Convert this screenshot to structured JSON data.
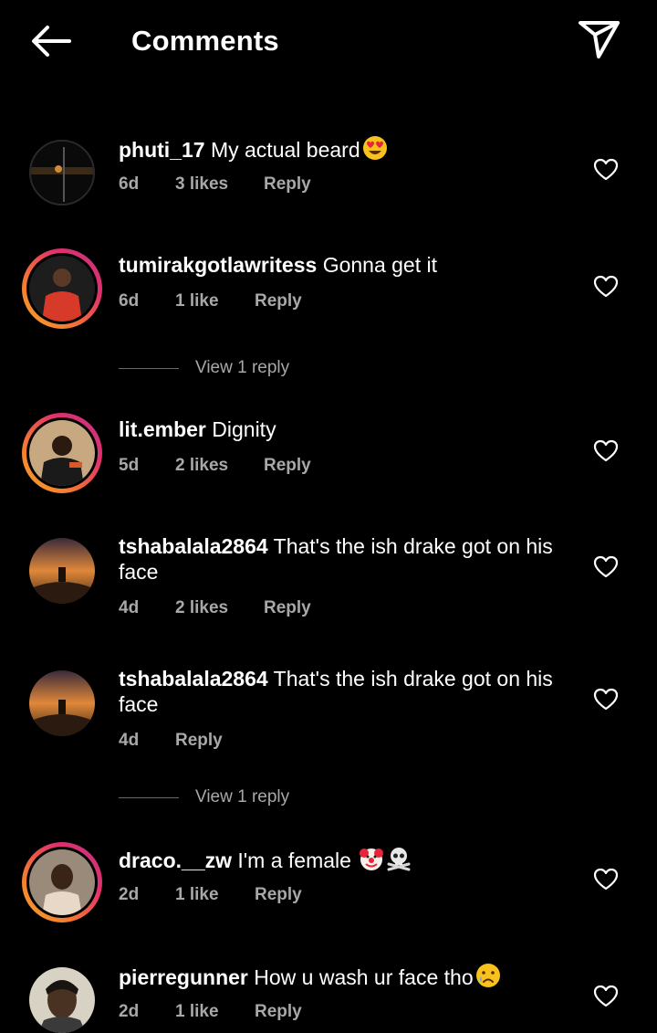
{
  "header": {
    "title": "Comments",
    "back_icon": "arrow-left-icon",
    "share_icon": "paper-plane-icon"
  },
  "comments": [
    {
      "username": "phuti_17",
      "text": "My actual beard",
      "emoji": "heart-eyes-icon",
      "time": "6d",
      "likes": "3 likes",
      "reply": "Reply"
    },
    {
      "username": "tumirakgotlawritess",
      "text": "Gonna get it",
      "time": "6d",
      "likes": "1 like",
      "reply": "Reply",
      "view_replies": "View 1 reply"
    },
    {
      "username": "lit.ember",
      "text": "Dignity",
      "time": "5d",
      "likes": "2 likes",
      "reply": "Reply"
    },
    {
      "username": "tshabalala2864",
      "text": "That's the ish drake got on his face",
      "time": "4d",
      "likes": "2 likes",
      "reply": "Reply"
    },
    {
      "username": "tshabalala2864",
      "text": "That's the ish drake got on his face",
      "time": "4d",
      "reply": "Reply",
      "view_replies": "View 1 reply"
    },
    {
      "username": "draco.__zw",
      "text": "I'm a female",
      "emoji": "clown-skull-icons",
      "time": "2d",
      "likes": "1 like",
      "reply": "Reply"
    },
    {
      "username": "pierregunner",
      "text": "How u wash ur face tho",
      "emoji": "sad-tear-icon",
      "time": "2d",
      "likes": "1 like",
      "reply": "Reply"
    }
  ],
  "colors": {
    "background": "#000000",
    "text": "#ffffff",
    "secondary_text": "#a8a8a8",
    "story_ring": "#e1306c"
  }
}
